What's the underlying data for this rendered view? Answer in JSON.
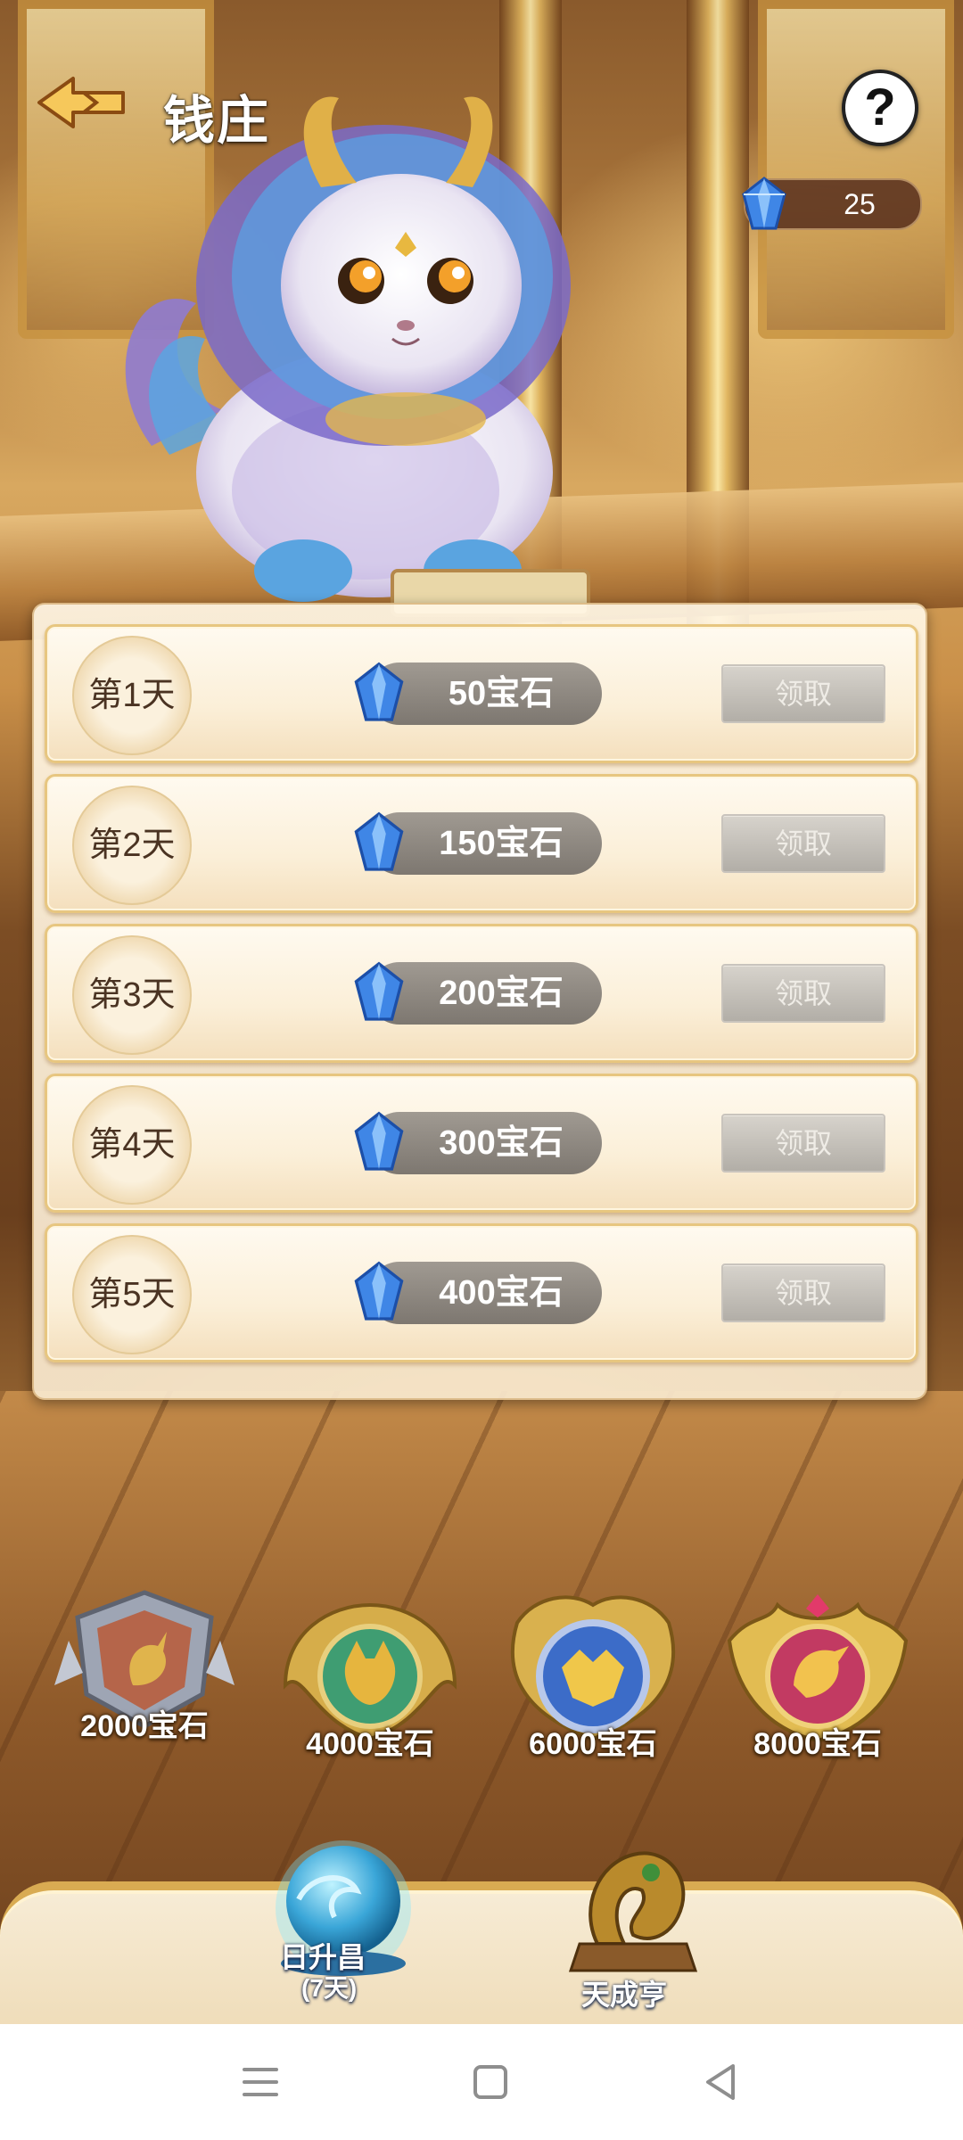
{
  "header": {
    "title": "钱庄",
    "help_label": "?",
    "gem_count": "25"
  },
  "rewards": [
    {
      "day": "第1天",
      "amount": "50宝石",
      "claim_label": "领取"
    },
    {
      "day": "第2天",
      "amount": "150宝石",
      "claim_label": "领取"
    },
    {
      "day": "第3天",
      "amount": "200宝石",
      "claim_label": "领取"
    },
    {
      "day": "第4天",
      "amount": "300宝石",
      "claim_label": "领取"
    },
    {
      "day": "第5天",
      "amount": "400宝石",
      "claim_label": "领取"
    }
  ],
  "milestones": [
    {
      "label": "2000宝石",
      "icon": "unicorn-shield-icon"
    },
    {
      "label": "4000宝石",
      "icon": "wolf-medal-icon"
    },
    {
      "label": "6000宝石",
      "icon": "dragon-medal-icon"
    },
    {
      "label": "8000宝石",
      "icon": "eagle-medal-icon"
    }
  ],
  "tabs": [
    {
      "label": "日升昌",
      "sublabel": "(7天)",
      "icon": "blue-orb-icon",
      "selected": true
    },
    {
      "label": "天成亨",
      "icon": "gold-dragon-icon",
      "selected": false
    }
  ],
  "colors": {
    "claim_disabled": "#b8b4ad",
    "reward_pill": "#8b857e",
    "panel_bg": "#fbefd8",
    "gold_border": "#e7c680"
  },
  "system_nav": [
    "menu-icon",
    "home-icon",
    "back-triangle-icon"
  ]
}
